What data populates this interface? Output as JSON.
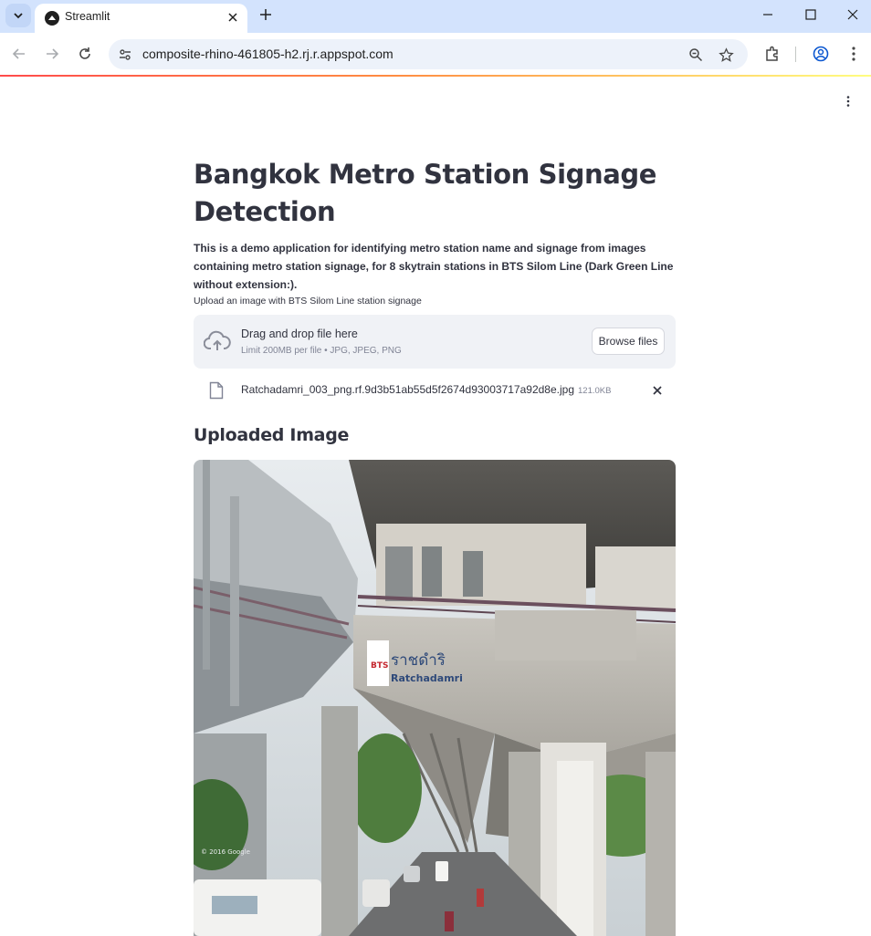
{
  "browser": {
    "tab_title": "Streamlit",
    "url": "composite-rhino-461805-h2.rj.r.appspot.com",
    "icons": [
      "tab-search-icon",
      "streamlit-favicon-icon",
      "close-icon",
      "plus-icon",
      "minimize-icon",
      "maximize-icon",
      "close-window-icon",
      "back-arrow-icon",
      "forward-arrow-icon",
      "reload-icon",
      "site-info-icon",
      "zoom-icon",
      "star-icon",
      "extensions-icon",
      "profile-icon",
      "more-vert-icon"
    ]
  },
  "app": {
    "title": "Bangkok Metro Station Signage Detection",
    "description": "This is a demo application for identifying metro station name and signage from images containing metro station signage, for 8 skytrain stations in BTS Silom Line (Dark Green Line without extension:).",
    "uploader": {
      "label": "Upload an image with BTS Silom Line station signage",
      "drag_text": "Drag and drop file here",
      "limit_text": "Limit 200MB per file • JPG, JPEG, PNG",
      "browse_label": "Browse files"
    },
    "uploaded_file": {
      "name": "Ratchadamri_003_png.rf.9d3b51ab55d5f2674d93003717a92d8e.jpg",
      "size": "121.0KB"
    },
    "section_heading": "Uploaded Image",
    "image": {
      "sign_thai": "ราชดำริ",
      "sign_english": "Ratchadamri",
      "sign_logo": "BTS",
      "watermark": "© 2016 Google"
    }
  },
  "colors": {
    "tabbar": "#d3e3fd",
    "omnibox": "#edf2fa",
    "text": "#31333f",
    "muted": "#808495",
    "dropzone": "#f0f2f6",
    "accent": "#ff4b4b"
  }
}
